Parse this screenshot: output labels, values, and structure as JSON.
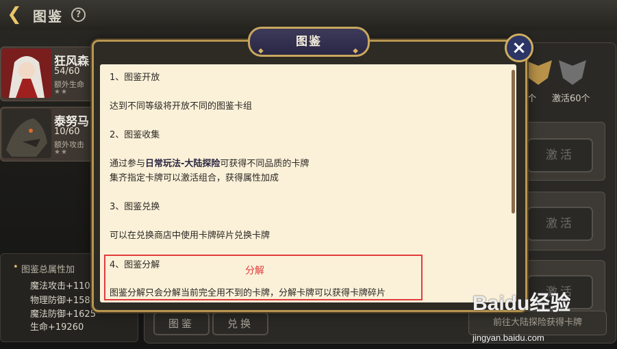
{
  "header": {
    "title": "图鉴",
    "help": "?"
  },
  "cards": [
    {
      "name": "狂风森",
      "count": "54/60",
      "attr": "额外生命",
      "stars": "★★"
    },
    {
      "name": "泰努马",
      "count": "10/60",
      "attr": "额外攻击",
      "stars": "★★"
    }
  ],
  "bonus_panel": {
    "title": "图鉴总属性加",
    "lines": [
      "魔法攻击+110",
      "物理防御+158",
      "魔法防御+1625",
      "生命+19260"
    ]
  },
  "trophies": [
    {
      "label": "0个"
    },
    {
      "label": "激活60个"
    }
  ],
  "activate_buttons": [
    "激活",
    "激活",
    "激活"
  ],
  "bottom_tabs": [
    "图鉴",
    "兑换"
  ],
  "goto_button": "前往大陆探险获得卡牌",
  "modal": {
    "title": "图鉴",
    "close": "×",
    "sections": [
      {
        "heading": "1、图鉴开放",
        "body": [
          "达到不同等级将开放不同的图鉴卡组"
        ]
      },
      {
        "heading": "2、图鉴收集",
        "body_rich": {
          "prefix": "通过参与",
          "highlight": "日常玩法-大陆探险",
          "suffix": "可获得不同品质的卡牌"
        },
        "body": [
          "集齐指定卡牌可以激活组合，获得属性加成"
        ]
      },
      {
        "heading": "3、图鉴兑换",
        "body": [
          "可以在兑换商店中使用卡牌碎片兑换卡牌"
        ]
      },
      {
        "heading": "4、图鉴分解",
        "body": [
          "图鉴分解只会分解当前完全用不到的卡牌，分解卡牌可以获得卡牌碎片"
        ]
      }
    ]
  },
  "annotation": {
    "text": "分解",
    "color": "#e23a3a"
  },
  "watermark": {
    "logo": "Baidu经验",
    "url": "jingyan.baidu.com"
  }
}
